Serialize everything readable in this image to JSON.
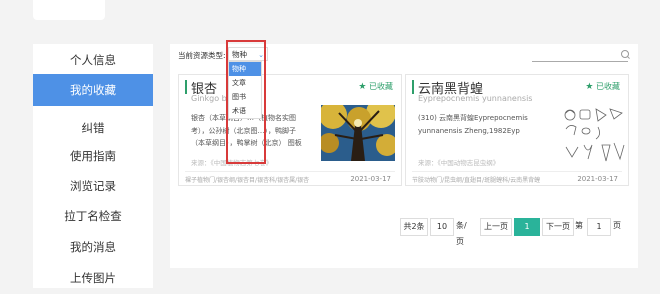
{
  "sidebar": {
    "items": [
      {
        "label": "个人信息",
        "active": false
      },
      {
        "label": "我的收藏",
        "active": true
      },
      {
        "label": "纠错",
        "active": false
      },
      {
        "label": "使用指南",
        "active": false
      },
      {
        "label": "浏览记录",
        "active": false
      },
      {
        "label": "拉丁名检查",
        "active": false
      },
      {
        "label": "我的消息",
        "active": false
      },
      {
        "label": "上传图片",
        "active": false
      }
    ]
  },
  "filter": {
    "label": "当前资源类型:",
    "selected": "物种",
    "options": [
      "物种",
      "文章",
      "图书",
      "术语"
    ]
  },
  "cards": [
    {
      "title": "银杏",
      "latin": "Ginkgo bi",
      "fav_label": "已收藏",
      "desc_lines": [
        "银杏（本草纲目）…（植物名实图",
        "考），公孙树（北京图…），鸭脚子",
        "（本草纲目），鸭掌树（北京）   图板"
      ],
      "source": "来源：《中国植物志第七卷》",
      "tags": "裸子植物门/银杏纲/银杏目/银杏科/银杏属/银杏",
      "date": "2021-03-17"
    },
    {
      "title": "云南黑背蝗",
      "latin": "Eyprepocnemis yunnanensis",
      "fav_label": "已收藏",
      "desc_lines": [
        "(310) 云南黑背蝗Eyprepocnemis",
        "yunnanensis Zheng,1982Eyp"
      ],
      "source": "来源：《中国动物志昆虫纲》",
      "tags": "节肢动物门/昆虫纲/直翅目/斑腿蝗科/云南黑背蝗",
      "date": "2021-03-17"
    }
  ],
  "pager": {
    "total": "共2条",
    "page_size": "10",
    "per_page_suffix": "条/页",
    "prev": "上一页",
    "current": "1",
    "next": "下一页",
    "goto_prefix": "第",
    "goto_value": "1",
    "goto_suffix": "页"
  },
  "colors": {
    "accent_blue": "#4e91e6",
    "fav_green": "#2e9f6b",
    "pager_green": "#2ab39a",
    "highlight_red": "#d83a3a"
  }
}
